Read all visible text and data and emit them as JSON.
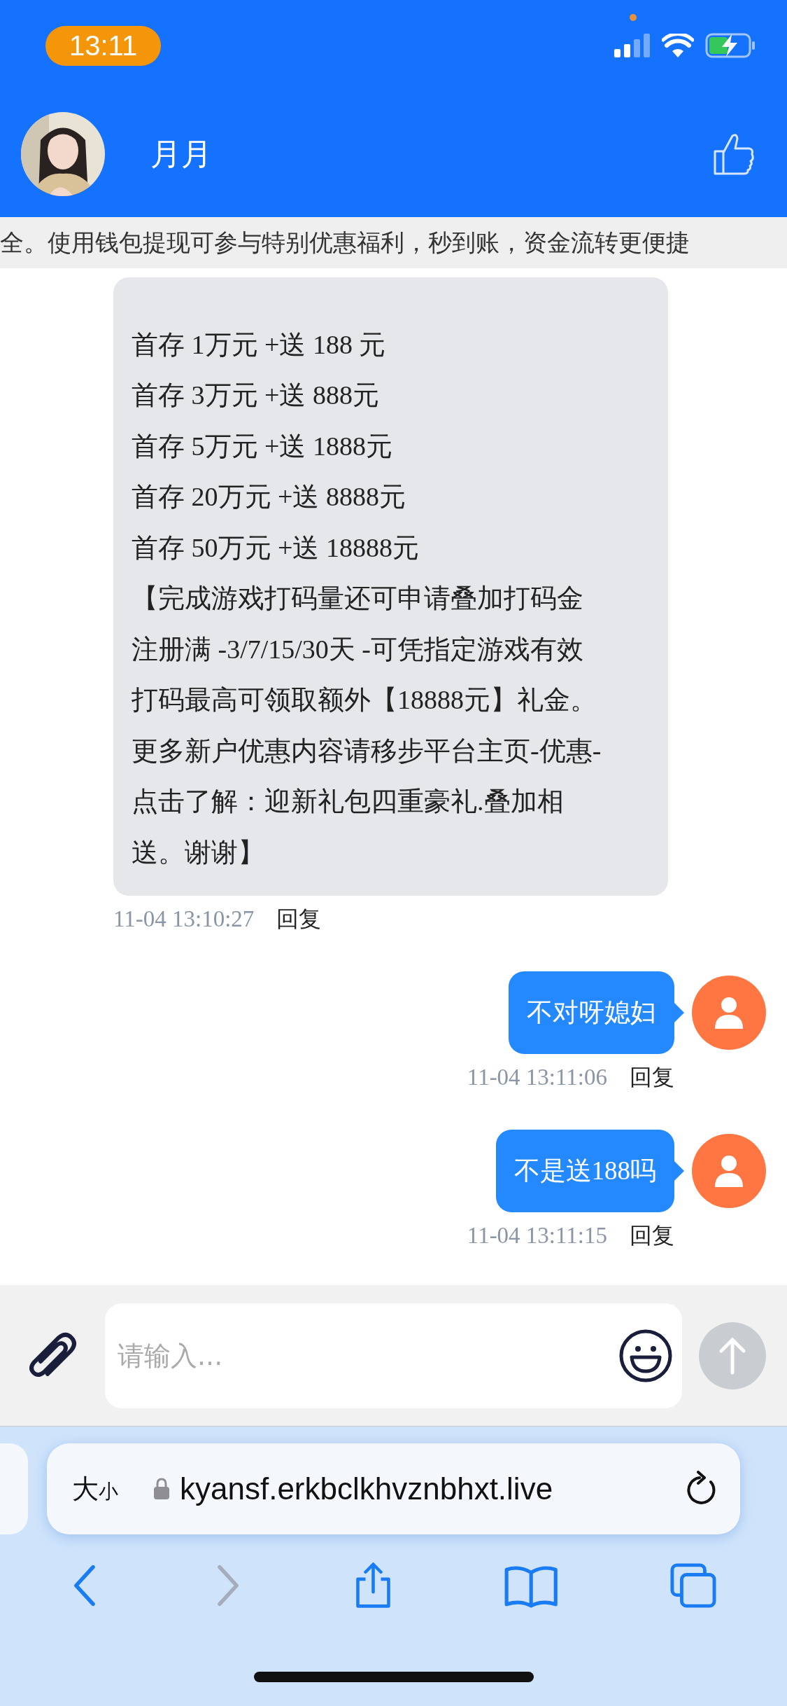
{
  "status_bar": {
    "time": "13:11"
  },
  "header": {
    "name": "月月"
  },
  "marquee": "全。使用钱包提现可参与特别优惠福利，秒到账，资金流转更便捷",
  "messages": [
    {
      "kind": "received",
      "lines": [
        "首存 1万元 +送 188 元",
        "首存 3万元 +送 888元",
        "首存 5万元 +送 1888元",
        "首存 20万元 +送 8888元",
        "首存 50万元 +送 18888元",
        "【完成游戏打码量还可申请叠加打码金",
        "注册满 -3/7/15/30天 -可凭指定游戏有效",
        "打码最高可领取额外【18888元】礼金。",
        "更多新户优惠内容请移步平台主页-优惠-",
        "点击了解：迎新礼包四重豪礼.叠加相",
        "送。谢谢】"
      ],
      "time": "11-04 13:10:27",
      "reply": "回复"
    },
    {
      "kind": "sent",
      "lines": [
        "不对呀媳妇"
      ],
      "time": "11-04 13:11:06",
      "reply": "回复"
    },
    {
      "kind": "sent",
      "lines": [
        "不是送188吗"
      ],
      "time": "11-04 13:11:15",
      "reply": "回复"
    }
  ],
  "input": {
    "placeholder": "请输入..."
  },
  "browser": {
    "text_size": [
      "大",
      "小"
    ],
    "url": "kyansf.erkbclkhvznbhxt.live"
  }
}
